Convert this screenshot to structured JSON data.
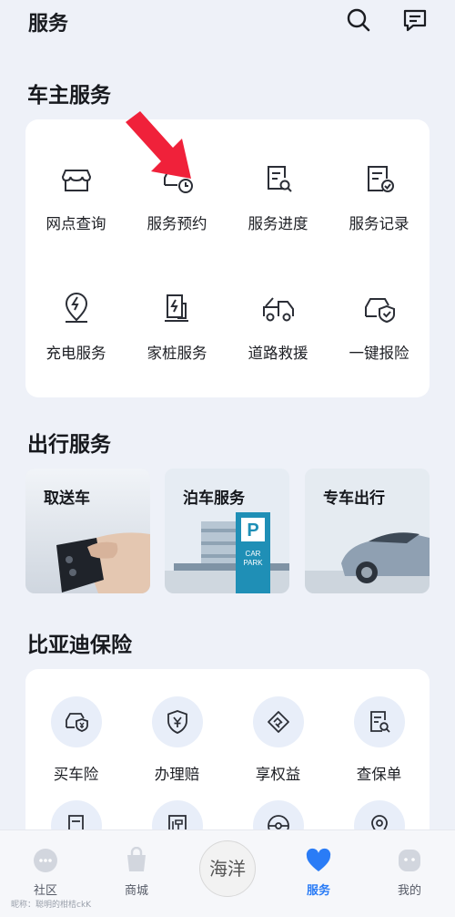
{
  "header": {
    "title": "服务",
    "icons": [
      "search-icon",
      "message-icon"
    ]
  },
  "car_owner": {
    "title": "车主服务",
    "items": [
      {
        "label": "网点查询",
        "icon": "store-icon"
      },
      {
        "label": "服务预约",
        "icon": "car-clock-icon"
      },
      {
        "label": "服务进度",
        "icon": "doc-search-icon"
      },
      {
        "label": "服务记录",
        "icon": "doc-check-icon"
      },
      {
        "label": "充电服务",
        "icon": "charge-pin-icon"
      },
      {
        "label": "家桩服务",
        "icon": "home-charger-icon"
      },
      {
        "label": "道路救援",
        "icon": "tow-truck-icon"
      },
      {
        "label": "一键报险",
        "icon": "car-shield-icon"
      }
    ]
  },
  "travel": {
    "title": "出行服务",
    "items": [
      {
        "label": "取送车",
        "image": "car-key-photo"
      },
      {
        "label": "泊车服务",
        "image": "car-park-photo"
      },
      {
        "label": "专车出行",
        "image": "car-photo"
      }
    ]
  },
  "insurance": {
    "title": "比亚迪保险",
    "items": [
      {
        "label": "买车险",
        "icon": "car-yuan-icon"
      },
      {
        "label": "办理赔",
        "icon": "shield-yuan-icon"
      },
      {
        "label": "享权益",
        "icon": "handshake-icon"
      },
      {
        "label": "查保单",
        "icon": "doc-search-icon"
      }
    ]
  },
  "tabbar": {
    "items": [
      {
        "label": "社区",
        "icon": "chat-icon"
      },
      {
        "label": "商城",
        "icon": "bag-icon"
      },
      {
        "label": "服务",
        "icon": "heart-icon",
        "active": true
      },
      {
        "label": "我的",
        "icon": "face-icon"
      }
    ],
    "center_logo": "海洋",
    "watermark": "昵称：聪明的柑桔ckK"
  },
  "colors": {
    "accent": "#2a7cf6",
    "annotation_arrow": "#f0213a"
  }
}
